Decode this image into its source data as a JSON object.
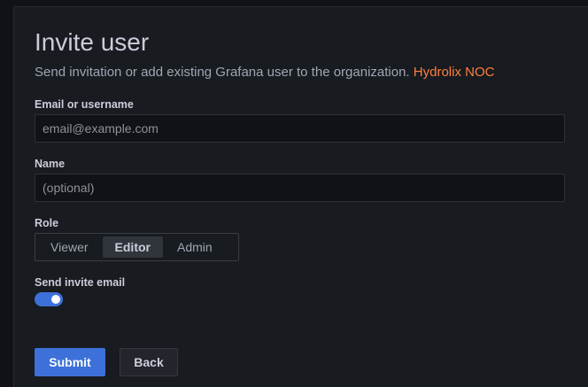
{
  "page": {
    "title": "Invite user",
    "subtitle": "Send invitation or add existing Grafana user to the organization.",
    "org_name": "Hydrolix NOC"
  },
  "form": {
    "email": {
      "label": "Email or username",
      "placeholder": "email@example.com",
      "value": ""
    },
    "name": {
      "label": "Name",
      "placeholder": "(optional)",
      "value": ""
    },
    "role": {
      "label": "Role",
      "options": [
        "Viewer",
        "Editor",
        "Admin"
      ],
      "selected": "Editor"
    },
    "send_email": {
      "label": "Send invite email",
      "enabled": true
    }
  },
  "actions": {
    "submit_label": "Submit",
    "back_label": "Back"
  },
  "colors": {
    "accent": "#3d71d9",
    "org_link": "#ff7f3f",
    "background": "#181b1f"
  }
}
